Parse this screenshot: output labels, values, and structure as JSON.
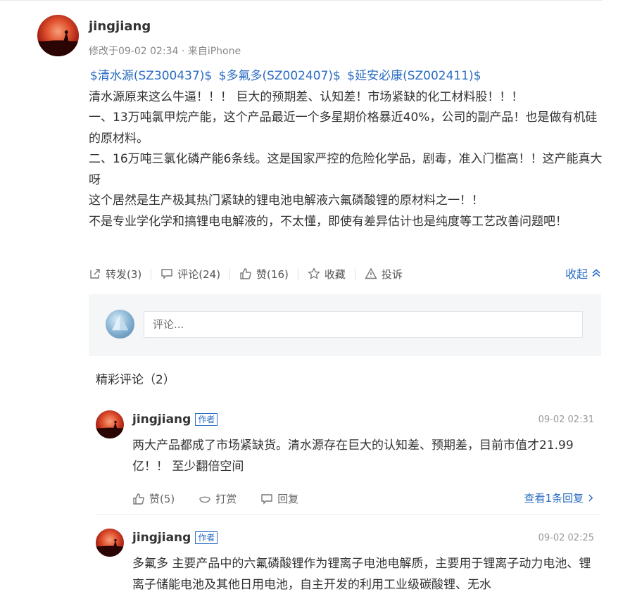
{
  "post": {
    "author": "jingjiang",
    "meta": "修改于09-02 02:34 · 来自iPhone",
    "tags": [
      "$清水源(SZ300437)$",
      "$多氟多(SZ002407)$",
      "$延安必康(SZ002411)$"
    ],
    "lines": [
      "清水源原来这么牛逼！！！ 巨大的预期差、认知差！市场紧缺的化工材料股！！！",
      "一、13万吨氯甲烷产能，这个产品最近一个多星期价格暴近40%，公司的副产品！也是做有机硅的原材料。",
      "二、16万吨三氯化磷产能6条线。这是国家严控的危险化学品，剧毒，准入门槛高！！这产能真大呀",
      "这个居然是生产极其热门紧缺的锂电池电解液六氟磷酸锂的原材料之一！！",
      "不是专业学化学和搞锂电电解液的，不太懂，即使有差异估计也是纯度等工艺改善问题吧！"
    ],
    "actions": {
      "repost": "转发(3)",
      "comment": "评论(24)",
      "like": "赞(16)",
      "favorite": "收藏",
      "report": "投诉",
      "collapse": "收起"
    }
  },
  "comment_input": {
    "placeholder": "评论..."
  },
  "featured": {
    "title": "精彩评论（2）"
  },
  "comments": [
    {
      "author": "jingjiang",
      "badge": "作者",
      "time": "09-02 02:31",
      "text": "两大产品都成了市场紧缺货。清水源存在巨大的认知差、预期差，目前市值才21.99亿！！ 至少翻倍空间",
      "like": "赞(5)",
      "reward": "打赏",
      "reply": "回复",
      "view_replies": "查看1条回复"
    },
    {
      "author": "jingjiang",
      "badge": "作者",
      "time": "09-02 02:25",
      "text": "多氟多 主要产品中的六氟磷酸锂作为锂离子电池电解质，主要用于锂离子动力电池、锂离子储能电池及其他日用电池，自主开发的利用工业级碳酸锂、无水"
    }
  ],
  "colors": {
    "link": "#2a6cc2",
    "meta": "#888888",
    "text": "#333333",
    "panel": "#f5f6f7"
  }
}
